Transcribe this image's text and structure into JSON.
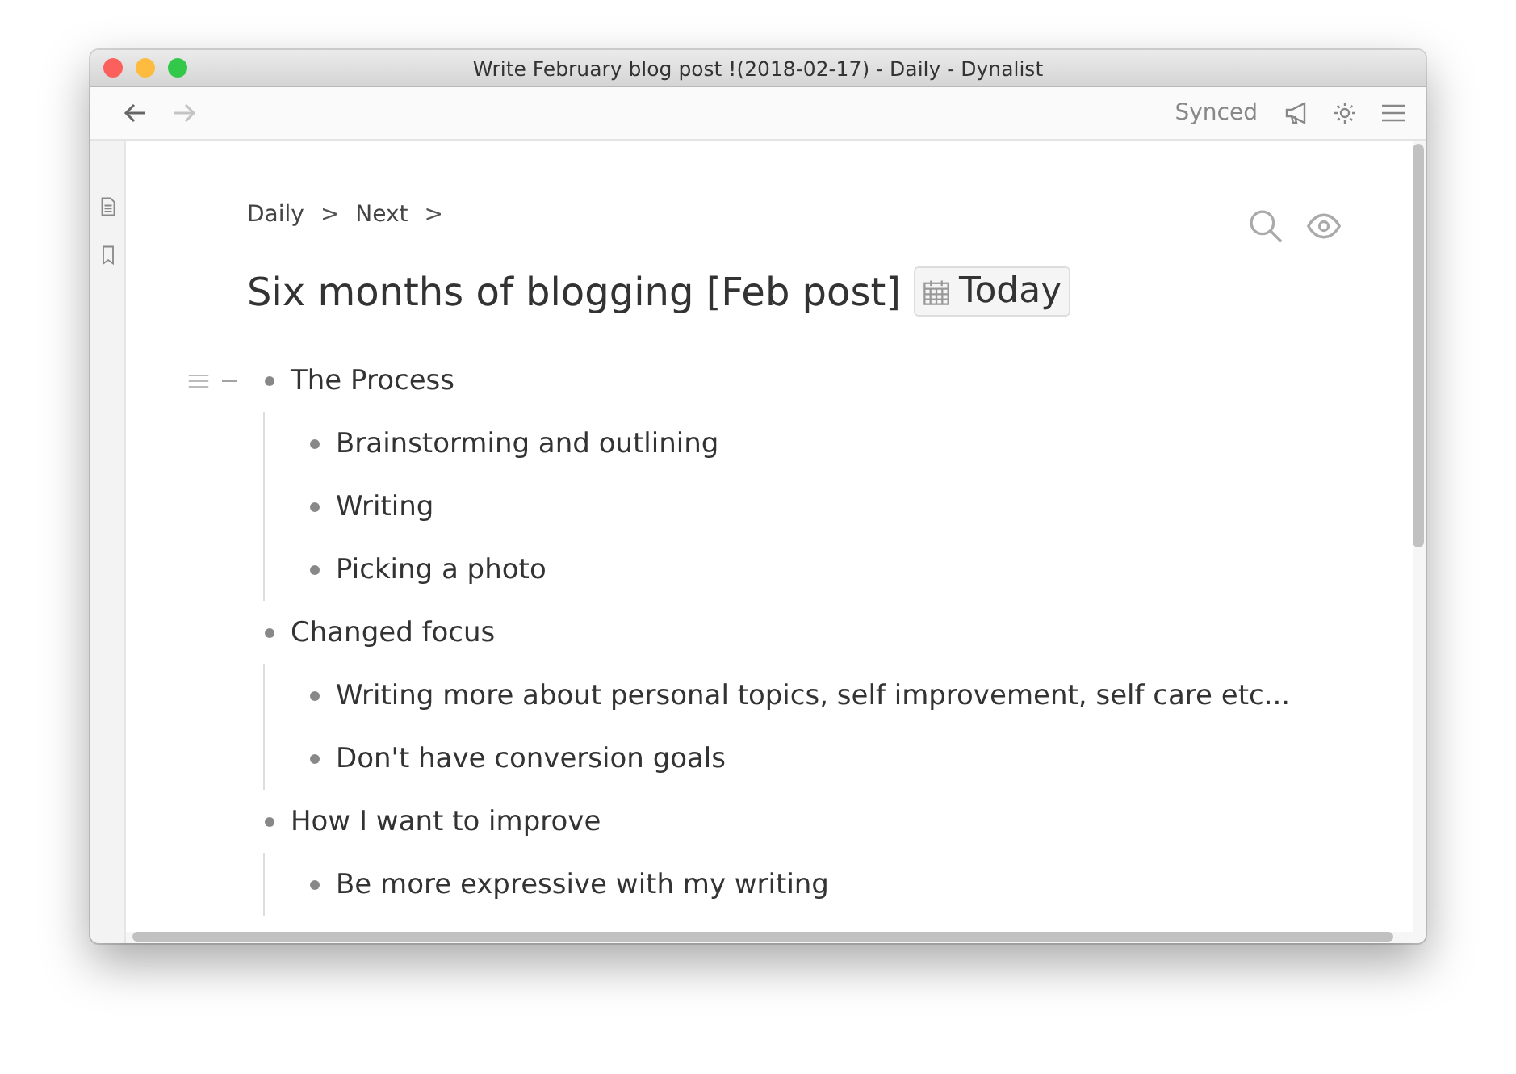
{
  "window": {
    "title": "Write February blog post !(2018-02-17) - Daily - Dynalist"
  },
  "toolbar": {
    "sync_status": "Synced",
    "forward_disabled": true
  },
  "breadcrumbs": [
    {
      "text": "Daily",
      "separator": ">"
    },
    {
      "text": "Next",
      "separator": ">"
    }
  ],
  "document": {
    "title": "Six months of blogging [Feb post]",
    "date_tag": "Today"
  },
  "items": [
    {
      "text": "The Process",
      "hovered": true,
      "children": [
        {
          "text": "Brainstorming and outlining"
        },
        {
          "text": "Writing"
        },
        {
          "text": "Picking a photo"
        }
      ]
    },
    {
      "text": "Changed focus",
      "hovered": false,
      "children": [
        {
          "text": "Writing more about personal topics, self improvement, self care etc..."
        },
        {
          "text": "Don't have conversion goals"
        }
      ]
    },
    {
      "text": "How I want to improve",
      "hovered": false,
      "children": [
        {
          "text": "Be more expressive with my writing"
        }
      ]
    }
  ]
}
